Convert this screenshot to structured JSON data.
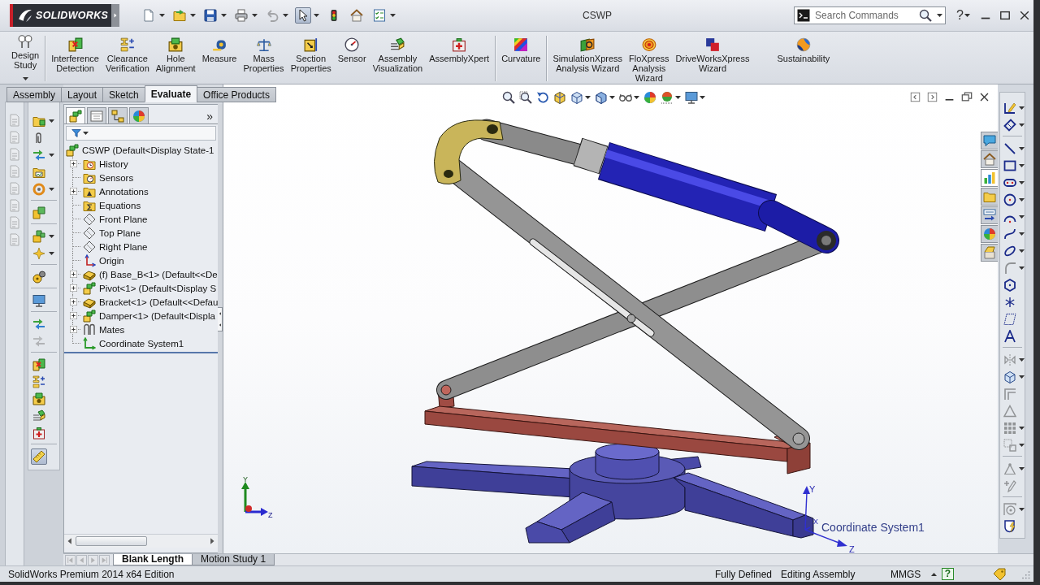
{
  "window": {
    "brand": "SOLIDWORKS",
    "title": "CSWP",
    "search_placeholder": "Search Commands",
    "help": "?"
  },
  "quick_access": [
    {
      "pressed": false,
      "disabled": false
    },
    {
      "pressed": false,
      "disabled": false
    },
    {
      "pressed": false,
      "disabled": false
    },
    {
      "pressed": false,
      "disabled": false
    },
    {
      "pressed": false,
      "disabled": true
    },
    {
      "pressed": true,
      "disabled": false
    },
    {
      "pressed": false,
      "disabled": false
    },
    {
      "pressed": false,
      "disabled": false
    },
    {
      "pressed": false,
      "disabled": false
    }
  ],
  "ribbon": {
    "groups": [
      [
        {
          "label": "Design\nStudy",
          "dropdown": true
        }
      ],
      [
        {
          "label": "Interference\nDetection",
          "dropdown": false
        },
        {
          "label": "Clearance\nVerification",
          "dropdown": false
        },
        {
          "label": "Hole\nAlignment",
          "dropdown": false
        },
        {
          "label": "Measure",
          "dropdown": false
        },
        {
          "label": "Mass\nProperties",
          "dropdown": false
        },
        {
          "label": "Section\nProperties",
          "dropdown": false
        },
        {
          "label": "Sensor",
          "dropdown": false
        },
        {
          "label": "Assembly\nVisualization",
          "dropdown": false
        },
        {
          "label": "AssemblyXpert",
          "dropdown": false
        }
      ],
      [
        {
          "label": "Curvature",
          "dropdown": false
        }
      ],
      [
        {
          "label": "SimulationXpress\nAnalysis Wizard",
          "dropdown": false
        },
        {
          "label": "FloXpress\nAnalysis\nWizard",
          "dropdown": false
        },
        {
          "label": "DriveWorksXpress\nWizard",
          "dropdown": false
        },
        {
          "label": "Sustainability",
          "dropdown": false
        }
      ]
    ]
  },
  "command_tabs": [
    {
      "label": "Assembly",
      "selected": false
    },
    {
      "label": "Layout",
      "selected": false
    },
    {
      "label": "Sketch",
      "selected": false
    },
    {
      "label": "Evaluate",
      "selected": true
    },
    {
      "label": "Office Products",
      "selected": false
    }
  ],
  "left_toolbar": [
    {
      "disabled": true
    },
    {
      "disabled": true
    },
    {
      "disabled": true
    },
    {
      "disabled": true
    },
    {
      "disabled": true
    },
    {
      "disabled": true
    },
    {
      "disabled": true
    },
    {
      "disabled": true
    }
  ],
  "assembly_toolbar": [
    {
      "pressed": false,
      "disabled": false
    },
    {
      "pressed": false,
      "disabled": false
    },
    {
      "pressed": false,
      "disabled": false
    },
    {
      "pressed": false,
      "disabled": false
    },
    {
      "pressed": false,
      "disabled": false
    },
    {
      "pressed": false,
      "disabled": false
    },
    {
      "pressed": false,
      "disabled": false
    },
    {
      "pressed": false,
      "disabled": false
    },
    {
      "pressed": false,
      "disabled": false
    },
    {
      "pressed": false,
      "disabled": false
    },
    {
      "pressed": false,
      "disabled": false
    },
    {
      "pressed": false,
      "disabled": true
    },
    {
      "pressed": false,
      "disabled": false
    },
    {
      "pressed": false,
      "disabled": false
    },
    {
      "pressed": false,
      "disabled": false
    },
    {
      "pressed": false,
      "disabled": false
    },
    {
      "pressed": false,
      "disabled": false
    },
    {
      "pressed": true,
      "disabled": false
    }
  ],
  "feature_manager": {
    "tabs": [
      {
        "selected": true
      },
      {
        "selected": false
      },
      {
        "selected": false
      },
      {
        "selected": false
      }
    ],
    "more": "»",
    "root": "CSWP (Default<Display State-1",
    "items": [
      {
        "label": "History",
        "kind": "history",
        "expandable": true
      },
      {
        "label": "Sensors",
        "kind": "sensors",
        "expandable": false
      },
      {
        "label": "Annotations",
        "kind": "annotations",
        "expandable": true
      },
      {
        "label": "Equations",
        "kind": "equations",
        "expandable": false
      },
      {
        "label": "Front Plane",
        "kind": "plane",
        "expandable": false
      },
      {
        "label": "Top Plane",
        "kind": "plane",
        "expandable": false
      },
      {
        "label": "Right Plane",
        "kind": "plane",
        "expandable": false
      },
      {
        "label": "Origin",
        "kind": "origin",
        "expandable": false
      },
      {
        "label": "(f) Base_B<1> (Default<<De",
        "kind": "part",
        "expandable": true
      },
      {
        "label": "Pivot<1> (Default<Display S",
        "kind": "subassembly",
        "expandable": true
      },
      {
        "label": "Bracket<1> (Default<<Defau",
        "kind": "part",
        "expandable": true
      },
      {
        "label": "Damper<1> (Default<Displa",
        "kind": "subassembly",
        "expandable": true
      },
      {
        "label": "Mates",
        "kind": "mates",
        "expandable": true
      },
      {
        "label": "Coordinate System1",
        "kind": "coordinate",
        "expandable": false
      }
    ]
  },
  "viewport": {
    "triad": {
      "y": "Y",
      "z": "Z"
    },
    "coordinate_system": {
      "label": "Coordinate System1",
      "y": "Y",
      "x": "X",
      "z": "Z"
    },
    "task_pane_tabs": [
      {
        "selected": false
      },
      {
        "selected": false
      },
      {
        "selected": true
      },
      {
        "selected": false
      },
      {
        "selected": false
      },
      {
        "selected": false
      },
      {
        "selected": false
      }
    ]
  },
  "sketch_toolbar": [
    {
      "disabled": false
    },
    {
      "disabled": false
    },
    {
      "disabled": false
    },
    {
      "disabled": false
    },
    {
      "disabled": false
    },
    {
      "disabled": false
    },
    {
      "disabled": false
    },
    {
      "disabled": false
    },
    {
      "disabled": false
    },
    {
      "disabled": true
    },
    {
      "disabled": false
    },
    {
      "disabled": false
    },
    {
      "disabled": false
    },
    {
      "disabled": false
    },
    {
      "disabled": true
    },
    {
      "disabled": false
    },
    {
      "disabled": true
    },
    {
      "disabled": true
    },
    {
      "disabled": true
    },
    {
      "disabled": true
    },
    {
      "disabled": true
    },
    {
      "disabled": true
    },
    {
      "disabled": true
    },
    {
      "disabled": false
    }
  ],
  "motion_nav": [
    {
      "disabled": true
    },
    {
      "disabled": true
    },
    {
      "disabled": true
    },
    {
      "disabled": true
    }
  ],
  "motion_tabs": [
    {
      "label": "Blank Length",
      "selected": true
    },
    {
      "label": "Motion Study 1",
      "selected": false
    }
  ],
  "status_bar": {
    "edition": "SolidWorks Premium 2014 x64 Edition",
    "sketch_state": "Fully Defined",
    "mode": "Editing Assembly",
    "units": "MMGS",
    "help": "?"
  }
}
